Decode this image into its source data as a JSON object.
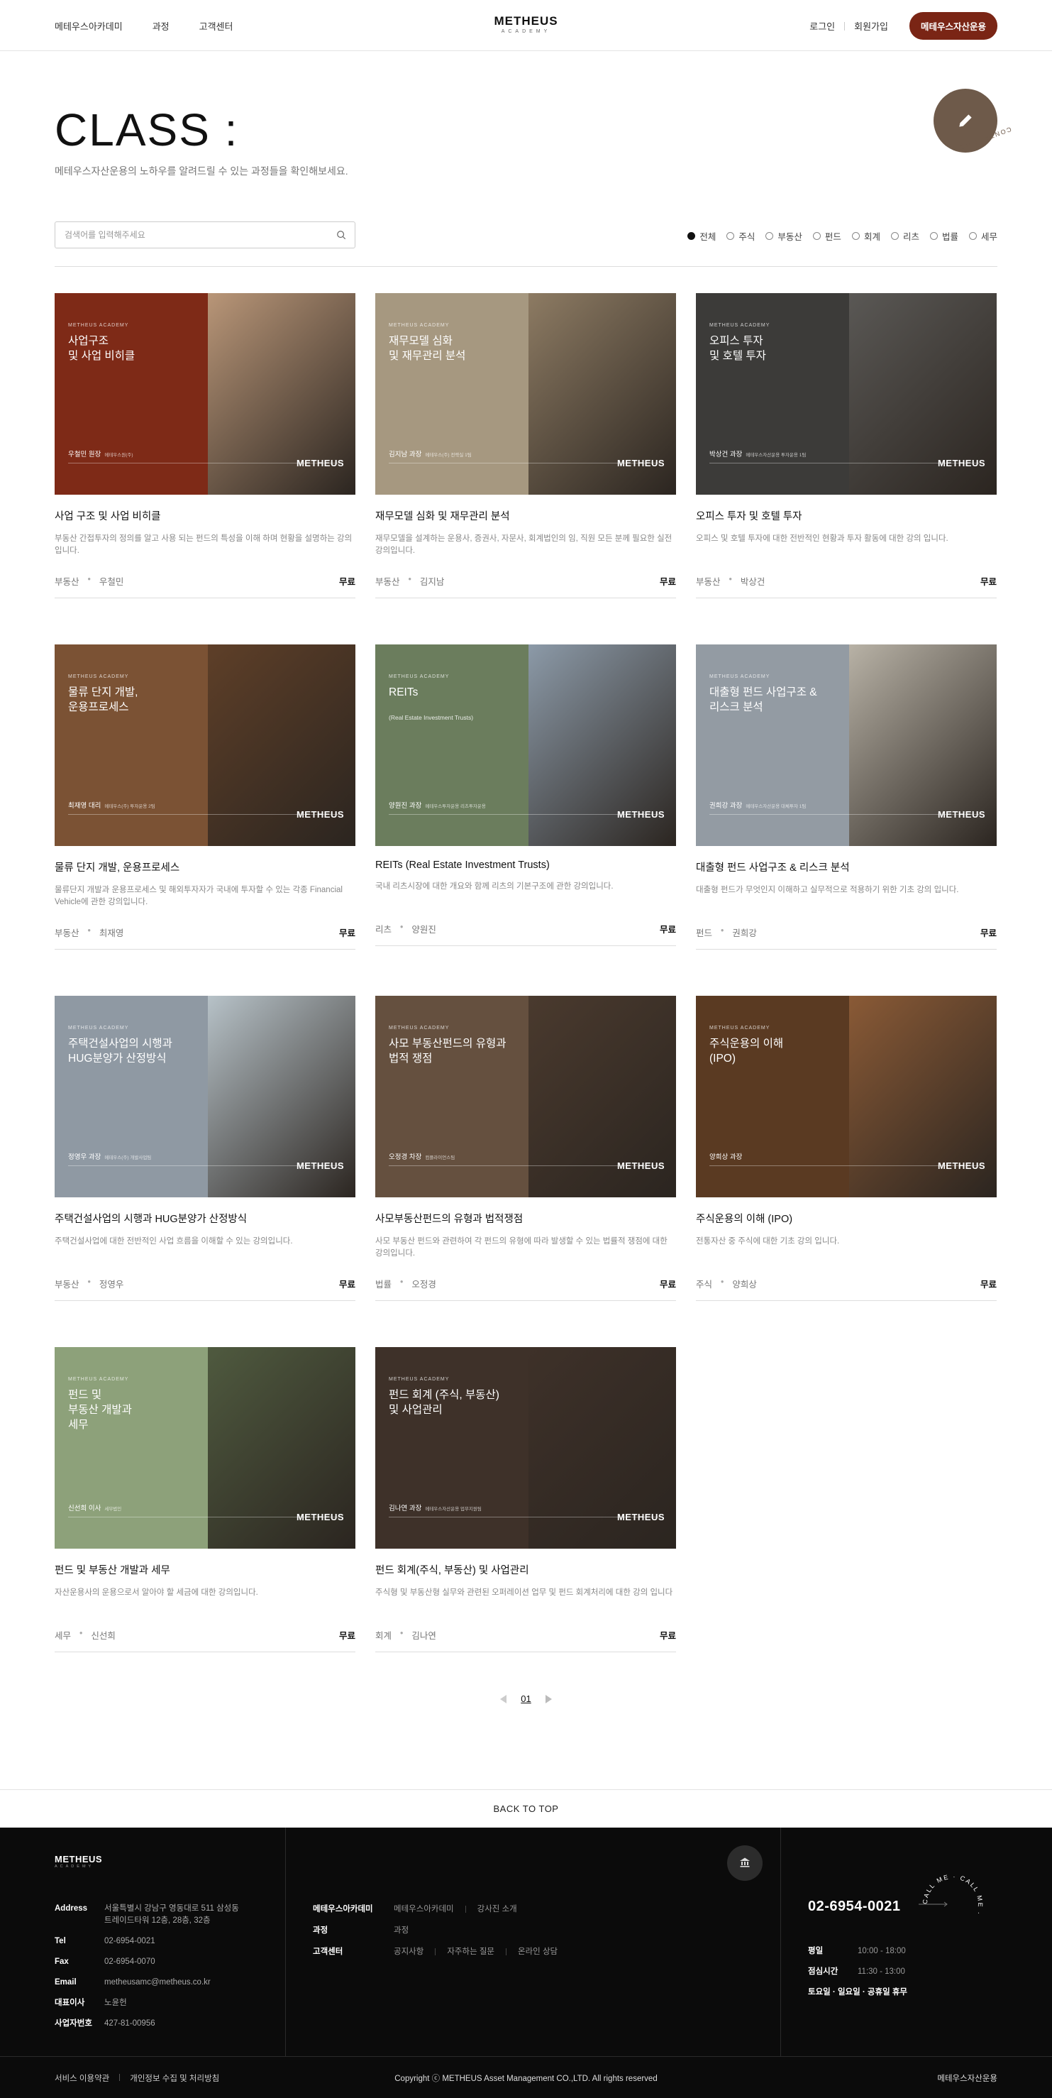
{
  "header": {
    "nav_left": [
      "메테우스아카데미",
      "과정",
      "고객센터"
    ],
    "logo": "METHEUS",
    "logo_sub": "ACADEMY",
    "login": "로그인",
    "signup": "회원가입",
    "cta": "메테우스자산운용"
  },
  "page": {
    "title": "CLASS :",
    "subtitle": "메테우스자산운용의 노하우를 알려드릴 수 있는 과정들을 확인해보세요.",
    "contact_label": "CONTACT US"
  },
  "search": {
    "placeholder": "검색어를 입력해주세요",
    "value": ""
  },
  "filters": [
    {
      "label": "전체",
      "selected": true
    },
    {
      "label": "주식",
      "selected": false
    },
    {
      "label": "부동산",
      "selected": false
    },
    {
      "label": "펀드",
      "selected": false
    },
    {
      "label": "회계",
      "selected": false
    },
    {
      "label": "리츠",
      "selected": false
    },
    {
      "label": "법률",
      "selected": false
    },
    {
      "label": "세무",
      "selected": false
    }
  ],
  "thumb_brand": "METHEUS ACADEMY",
  "thumb_logo": "METHEUS",
  "courses": [
    {
      "thumb_title": "사업구조\n및 사업 비히클",
      "thumb_sub": "",
      "instructor_tag": "우철민 원장",
      "instructor_small": "메테우스원(주)",
      "title": "사업 구조 및 사업 비히클",
      "desc": "부동산 간접투자의 정의를 알고 사용 되는 펀드의 특성을 이해 하며 현황을 설명하는 강의입니다.",
      "category": "부동산",
      "instructor": "우철민",
      "price": "무료",
      "left_color": "#7e2a17",
      "right_color": "#b99678"
    },
    {
      "thumb_title": "재무모델 심화\n및 재무관리 분석",
      "thumb_sub": "",
      "instructor_tag": "김지남 과장",
      "instructor_small": "메테우스(주) 전략실 1팀",
      "title": "재무모델 심화 및 재무관리 분석",
      "desc": "재무모델을 설계하는 운용사, 증권사, 자문사, 회계법인의 임, 직원 모든 분께 필요한 실전 강의입니다.",
      "category": "부동산",
      "instructor": "김지남",
      "price": "무료",
      "left_color": "#a69880",
      "right_color": "#8d7b63"
    },
    {
      "thumb_title": "오피스 투자\n및 호텔 투자",
      "thumb_sub": "",
      "instructor_tag": "박상건 과장",
      "instructor_small": "메테우스자산운용 투자운용 1팀",
      "title": "오피스 투자 및 호텔 투자",
      "desc": "오피스 및 호텔 투자에 대한 전반적인 현황과 투자 활동에 대한 강의 입니다.",
      "category": "부동산",
      "instructor": "박상건",
      "price": "무료",
      "left_color": "#3c3b39",
      "right_color": "#5a5855"
    },
    {
      "thumb_title": "물류 단지 개발,\n운용프로세스",
      "thumb_sub": "",
      "instructor_tag": "최재영 대리",
      "instructor_small": "메테우스(주) 투자운용 2팀",
      "title": "물류 단지 개발, 운용프로세스",
      "desc": "물류단지 개발과 운용프로세스 및 해외투자자가 국내에 투자할 수 있는 각종 Financial Vehicle에 관한 강의입니다.",
      "category": "부동산",
      "instructor": "최재영",
      "price": "무료",
      "left_color": "#7b5234",
      "right_color": "#5e3f28"
    },
    {
      "thumb_title": "REITs",
      "thumb_sub": "(Real Estate Investment Trusts)",
      "instructor_tag": "양원진 과장",
      "instructor_small": "메테우스투자운용 리츠투자운용",
      "title": "REITs (Real Estate Investment Trusts)",
      "desc": "국내 리츠시장에 대한 개요와 함께 리츠의 기본구조에 관한 강의입니다.",
      "category": "리츠",
      "instructor": "양원진",
      "price": "무료",
      "left_color": "#6b7d5d",
      "right_color": "#8c9aa8"
    },
    {
      "thumb_title": "대출형 펀드 사업구조 &\n리스크 분석",
      "thumb_sub": "",
      "instructor_tag": "권희강 과장",
      "instructor_small": "메테우스자산운용 대체투자 1팀",
      "title": "대출형 펀드 사업구조 & 리스크 분석",
      "desc": "대출형 펀드가 무엇인지 이해하고 실무적으로 적용하기 위한 기초 강의 입니다.",
      "category": "펀드",
      "instructor": "권희강",
      "price": "무료",
      "left_color": "#939ba3",
      "right_color": "#b8b2a6"
    },
    {
      "thumb_title": "주택건설사업의 시행과\nHUG분양가 산정방식",
      "thumb_sub": "",
      "instructor_tag": "정영우 과장",
      "instructor_small": "메테우스(주) 개발사업팀",
      "title": "주택건설사업의 시행과 HUG분양가 산정방식",
      "desc": "주택건설사업에 대한 전반적인 사업 흐름을 이해할 수 있는 강의입니다.",
      "category": "부동산",
      "instructor": "정영우",
      "price": "무료",
      "left_color": "#8f99a3",
      "right_color": "#b7c2c8"
    },
    {
      "thumb_title": "사모 부동산펀드의 유형과\n법적 쟁점",
      "thumb_sub": "",
      "instructor_tag": "오정경 차장",
      "instructor_small": "컴플라이언스팀",
      "title": "사모부동산펀드의 유형과 법적쟁점",
      "desc": "사모 부동산 펀드와 관련하여 각 펀드의 유형에 따라 발생할 수 있는 법률적 쟁점에 대한 강의입니다.",
      "category": "법률",
      "instructor": "오정경",
      "price": "무료",
      "left_color": "#65503f",
      "right_color": "#4a3a2e"
    },
    {
      "thumb_title": "주식운용의 이해\n(IPO)",
      "thumb_sub": "",
      "instructor_tag": "양희상 과장",
      "instructor_small": "",
      "title": "주식운용의 이해 (IPO)",
      "desc": "전통자산 중 주식에 대한 기초 강의 입니다.",
      "category": "주식",
      "instructor": "양희상",
      "price": "무료",
      "left_color": "#5a3a22",
      "right_color": "#8a5a36"
    },
    {
      "thumb_title": "펀드 및\n부동산 개발과\n세무",
      "thumb_sub": "",
      "instructor_tag": "신선희 이사",
      "instructor_small": "세무법인",
      "title": "펀드 및 부동산 개발과 세무",
      "desc": "자산운용사의 운용으로서 알아야 할 세금에 대한 강의입니다.",
      "category": "세무",
      "instructor": "신선희",
      "price": "무료",
      "left_color": "#8da17a",
      "right_color": "#4f5a3f"
    },
    {
      "thumb_title": "펀드 회계 (주식, 부동산)\n및 사업관리",
      "thumb_sub": "",
      "instructor_tag": "김나연 과장",
      "instructor_small": "메테우스자산운용 업무지원팀",
      "title": "펀드 회계(주식, 부동산) 및 사업관리",
      "desc": "주식형 및 부동산형 실무와 관련된 오퍼레이션 업무 및 펀드 회계처리에 대한 강의 입니다",
      "category": "회계",
      "instructor": "김나연",
      "price": "무료",
      "left_color": "#3e3129",
      "right_color": "#3e3129"
    }
  ],
  "pagination": {
    "current": "01"
  },
  "back_to_top": "BACK TO TOP",
  "footer": {
    "logo": "METHEUS",
    "logo_sub": "ACADEMY",
    "address_label": "Address",
    "address": "서울특별시 강남구 영동대로 511 삼성동\n트레이드타워 12층, 28층, 32층",
    "tel_label": "Tel",
    "tel": "02-6954-0021",
    "fax_label": "Fax",
    "fax": "02-6954-0070",
    "email_label": "Email",
    "email": "metheusamc@metheus.co.kr",
    "ceo_label": "대표이사",
    "ceo": "노윤헌",
    "bizno_label": "사업자번호",
    "bizno": "427-81-00956",
    "menu": [
      {
        "key": "메테우스아카데미",
        "items": [
          "메테우스아카데미",
          "강사진 소개"
        ]
      },
      {
        "key": "과정",
        "items": [
          "과정"
        ]
      },
      {
        "key": "고객센터",
        "items": [
          "공지사항",
          "자주하는 질문",
          "온라인 상담"
        ]
      }
    ],
    "phone": "02-6954-0021",
    "call_label": "CALL ME · CALL ME ·",
    "hours": [
      {
        "k": "평일",
        "v": "10:00 - 18:00"
      },
      {
        "k": "점심시간",
        "v": "11:30 - 13:00"
      },
      {
        "k": "토요일 · 일요일 · 공휴일 휴무",
        "v": ""
      }
    ],
    "terms": "서비스 이용약관",
    "privacy": "개인정보 수집 및 처리방침",
    "copyright": "Copyright ⓒ METHEUS Asset Management CO.,LTD. All rights reserved",
    "company": "메테우스자산운용"
  }
}
